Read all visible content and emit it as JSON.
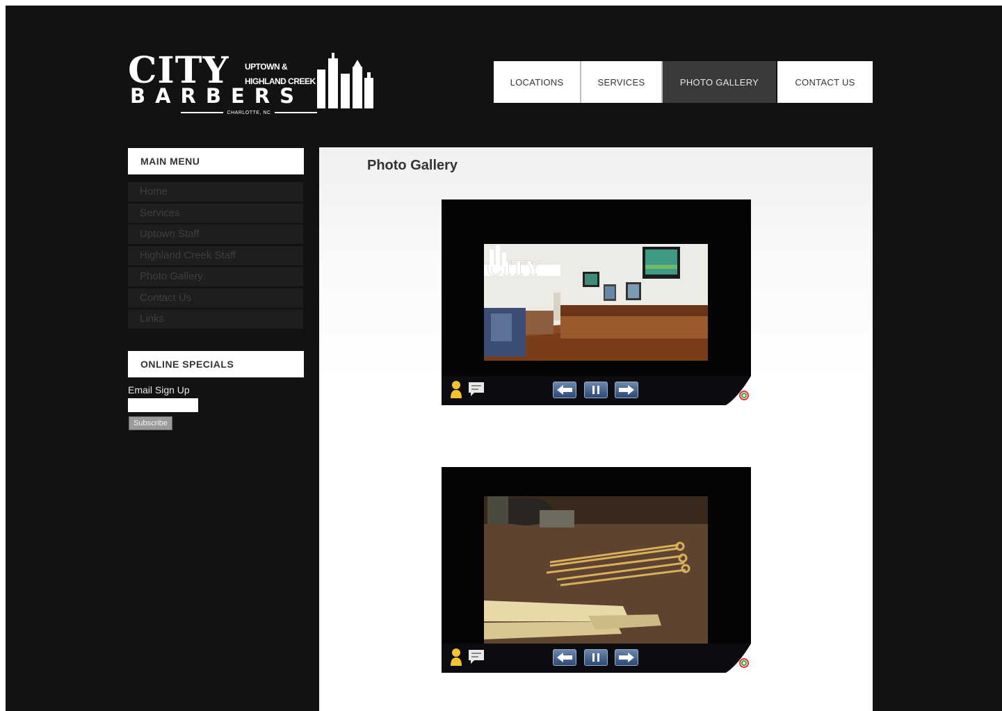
{
  "brand": {
    "name": "CITY",
    "sub_line1": "UPTOWN &",
    "sub_line2": "HIGHLAND CREEK",
    "name2": "BARBERS",
    "city": "CHARLOTTE, NC"
  },
  "topnav": {
    "items": [
      "LOCATIONS",
      "SERVICES",
      "PHOTO GALLERY",
      "CONTACT US"
    ],
    "active": "PHOTO GALLERY"
  },
  "sidebar": {
    "main_menu_title": "MAIN MENU",
    "menu_items": [
      "Home",
      "Services",
      "Uptown Staff",
      "Highland Creek Staff",
      "Photo Gallery",
      "Contact Us",
      "Links"
    ],
    "specials_title": "ONLINE SPECIALS",
    "email_label": "Email Sign Up",
    "email_value": "",
    "subscribe_label": "Subscribe"
  },
  "main": {
    "title": "Photo Gallery"
  },
  "galleries": [
    {
      "photo": "barbershop-interior",
      "controls": [
        "arrow-left-icon",
        "pause-icon",
        "arrow-right-icon"
      ]
    },
    {
      "photo": "scissors-and-combs",
      "controls": [
        "arrow-left-icon",
        "pause-icon",
        "arrow-right-icon"
      ]
    }
  ],
  "colors": {
    "page_background": "#121212",
    "panel": "#ffffff",
    "nav_active": "#3a3a3a",
    "button_blue": "#3b5a88"
  }
}
